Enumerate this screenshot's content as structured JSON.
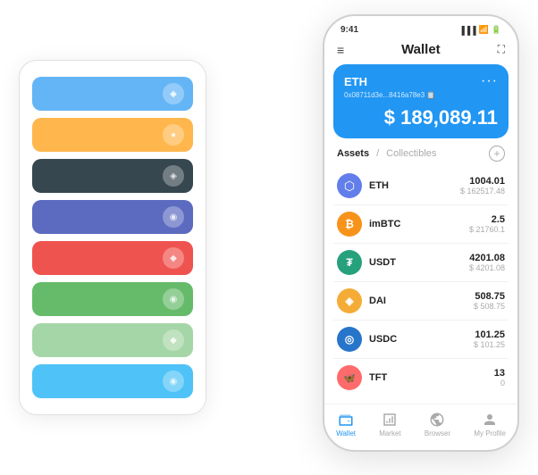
{
  "scene": {
    "cards": [
      {
        "color": "card-blue",
        "icon": "◆"
      },
      {
        "color": "card-orange",
        "icon": "●"
      },
      {
        "color": "card-dark",
        "icon": "◈"
      },
      {
        "color": "card-purple",
        "icon": "◉"
      },
      {
        "color": "card-red",
        "icon": "◆"
      },
      {
        "color": "card-green",
        "icon": "◉"
      },
      {
        "color": "card-light-green",
        "icon": "◆"
      },
      {
        "color": "card-sky",
        "icon": "◉"
      }
    ]
  },
  "phone": {
    "status_time": "9:41",
    "title": "Wallet",
    "eth_card": {
      "label": "ETH",
      "address": "0x08711d3e...8416a78e3  📋",
      "amount": "$ 189,089.11",
      "currency_symbol": "$"
    },
    "assets_tab": "Assets",
    "collectibles_tab": "Collectibles",
    "assets": [
      {
        "name": "ETH",
        "logo_class": "eth-logo",
        "logo_text": "⬡",
        "balance": "1004.01",
        "usd": "$ 162517.48"
      },
      {
        "name": "imBTC",
        "logo_class": "imbtc-logo",
        "logo_text": "₿",
        "balance": "2.5",
        "usd": "$ 21760.1"
      },
      {
        "name": "USDT",
        "logo_class": "usdt-logo",
        "logo_text": "₮",
        "balance": "4201.08",
        "usd": "$ 4201.08"
      },
      {
        "name": "DAI",
        "logo_class": "dai-logo",
        "logo_text": "◈",
        "balance": "508.75",
        "usd": "$ 508.75"
      },
      {
        "name": "USDC",
        "logo_class": "usdc-logo",
        "logo_text": "◎",
        "balance": "101.25",
        "usd": "$ 101.25"
      },
      {
        "name": "TFT",
        "logo_class": "tft-logo",
        "logo_text": "🦋",
        "balance": "13",
        "usd": "0"
      }
    ],
    "nav": [
      {
        "label": "Wallet",
        "icon": "◎",
        "active": true
      },
      {
        "label": "Market",
        "icon": "📊",
        "active": false
      },
      {
        "label": "Browser",
        "icon": "🌐",
        "active": false
      },
      {
        "label": "My Profile",
        "icon": "👤",
        "active": false
      }
    ]
  }
}
